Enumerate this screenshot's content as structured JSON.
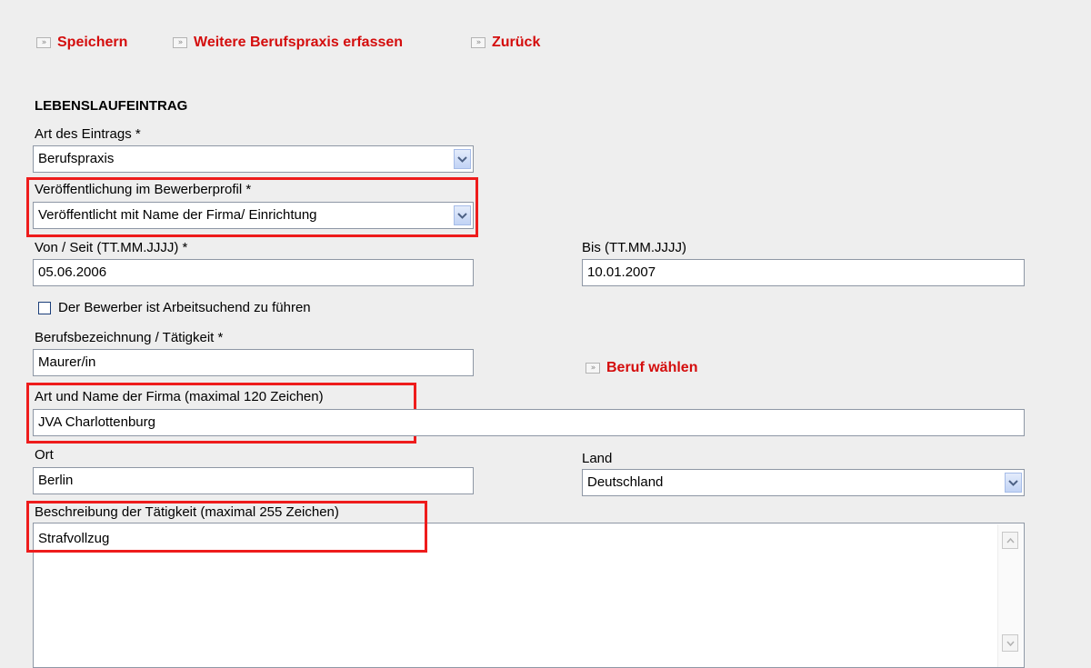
{
  "actions": {
    "save": "Speichern",
    "add_more": "Weitere Berufspraxis erfassen",
    "back": "Zurück"
  },
  "section_title": "LEBENSLAUFEINTRAG",
  "entry_type": {
    "label": "Art des Eintrags *",
    "value": "Berufspraxis"
  },
  "publication": {
    "label": "Veröffentlichung im Bewerberprofil *",
    "value": "Veröffentlicht mit Name der Firma/ Einrichtung"
  },
  "from": {
    "label": "Von / Seit (TT.MM.JJJJ) *",
    "value": "05.06.2006"
  },
  "to": {
    "label": "Bis (TT.MM.JJJJ)",
    "value": "10.01.2007"
  },
  "job_seeking": {
    "label": "Der Bewerber ist Arbeitsuchend zu führen",
    "checked": false
  },
  "job_title": {
    "label": "Berufsbezeichnung / Tätigkeit *",
    "value": "Maurer/in"
  },
  "choose_job": "Beruf wählen",
  "company": {
    "label": "Art und Name der Firma (maximal 120 Zeichen)",
    "value": "JVA Charlottenburg"
  },
  "city": {
    "label": "Ort",
    "value": "Berlin"
  },
  "country": {
    "label": "Land",
    "value": "Deutschland"
  },
  "description": {
    "label": "Beschreibung der Tätigkeit (maximal 255 Zeichen)",
    "value": "Strafvollzug"
  },
  "colors": {
    "accent_red": "#d40d0d",
    "highlight_box": "#ee1c1c",
    "background": "#eeeeee"
  }
}
